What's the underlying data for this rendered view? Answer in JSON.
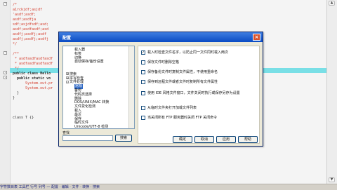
{
  "editor": {
    "lines": [
      {
        "text": "/*",
        "cls": "cmt"
      },
      {
        "text": "a1rckjdf;asjdf",
        "cls": "cmt"
      },
      {
        "text": "'asdf;asdf;",
        "cls": "cmt"
      },
      {
        "text": "asdf;asdfja",
        "cls": "cmt"
      },
      {
        "text": "sdf;asjdfsdf;asd;",
        "cls": "cmt"
      },
      {
        "text": "asdf;asdfasdf;asd",
        "cls": "cmt"
      },
      {
        "text": "asdfj;asdfj;asdf",
        "cls": "cmt"
      },
      {
        "text": "asdfj;asdfj;asdfj",
        "cls": "cmt"
      },
      {
        "text": "*/",
        "cls": "cmt"
      },
      {
        "text": "",
        "cls": "plain"
      },
      {
        "text": "/**",
        "cls": "cmt"
      },
      {
        "text": " * asdfasdfasdfasdf",
        "cls": "cmt"
      },
      {
        "text": " * asdfasdfasdfasdf",
        "cls": "cmt"
      },
      {
        "text": " */",
        "cls": "cmt"
      },
      {
        "text": "public class Hello",
        "cls": "kw"
      },
      {
        "text": "  public static vo",
        "cls": "kw"
      },
      {
        "text": "      System.out.pr",
        "cls": "cmt"
      },
      {
        "text": "      System.out.pr",
        "cls": "cmt"
      },
      {
        "text": "  }",
        "cls": "plain"
      },
      {
        "text": "}",
        "cls": "plain"
      },
      {
        "text": "",
        "cls": "plain"
      },
      {
        "text": "",
        "cls": "plain"
      },
      {
        "text": "",
        "cls": "plain"
      },
      {
        "text": "class T {}",
        "cls": "plain"
      }
    ]
  },
  "statusbar": {
    "text": "字符数目表 工具栏 行号 列号 — 配置 · 编辑 · 文件 · 转换 · 搜索"
  },
  "dialog": {
    "title": "配置",
    "close_glyph": "×",
    "tree": [
      {
        "label": "载入器",
        "indent": 1,
        "expander": ""
      },
      {
        "label": "标签",
        "indent": 1,
        "expander": ""
      },
      {
        "label": "切换",
        "indent": 1,
        "expander": ""
      },
      {
        "label": "自动保存/备份设置",
        "indent": 1,
        "expander": ""
      },
      {
        "label": "",
        "indent": 1,
        "expander": ""
      },
      {
        "label": "",
        "indent": 1,
        "expander": ""
      },
      {
        "label": "搜索",
        "indent": 0,
        "expander": "+"
      },
      {
        "label": "拼写检查",
        "indent": 0,
        "expander": "+"
      },
      {
        "label": "文件处理",
        "indent": 0,
        "expander": "-"
      },
      {
        "label": "常规",
        "indent": 1,
        "expander": "",
        "selected": true
      },
      {
        "label": "备份",
        "indent": 1,
        "expander": ""
      },
      {
        "label": "代码页选择",
        "indent": 1,
        "expander": ""
      },
      {
        "label": "删除",
        "indent": 1,
        "expander": ""
      },
      {
        "label": "DOS/UNIX/MAC 转换",
        "indent": 1,
        "expander": ""
      },
      {
        "label": "文件变化检测",
        "indent": 1,
        "expander": ""
      },
      {
        "label": "载入",
        "indent": 1,
        "expander": ""
      },
      {
        "label": "最近",
        "indent": 1,
        "expander": ""
      },
      {
        "label": "保存",
        "indent": 1,
        "expander": ""
      },
      {
        "label": "临时文件",
        "indent": 1,
        "expander": ""
      },
      {
        "label": "Unicode/UTF-8 检测",
        "indent": 1,
        "expander": ""
      }
    ],
    "options": [
      {
        "label": "载入时检查文件名字，以防止同一文件同时载入两次",
        "checked": true
      },
      {
        "label": "保存文件时删除空格",
        "checked": false
      },
      {
        "label": "保存备份文件时复制文件属性，不使用重命名",
        "checked": false
      },
      {
        "label": "保存到远程文件或者文件时复制所有文件属性",
        "checked": false
      },
      {
        "label": "使用 IDE 风格文件窗口，文件关闭时执行或保存另存为设置",
        "checked": false
      },
      {
        "label": "从临时文件夹打开加载文件列表",
        "checked": false
      },
      {
        "label": "当关闭所有 FTP 服务器时关闭 FTP 关闭命令",
        "checked": false
      }
    ],
    "check_glyph": "✓",
    "find_label": "查找",
    "find_value": "",
    "buttons": {
      "search": "搜索",
      "ok": "确定",
      "cancel": "取消",
      "apply": "应用",
      "help": "帮助"
    }
  }
}
